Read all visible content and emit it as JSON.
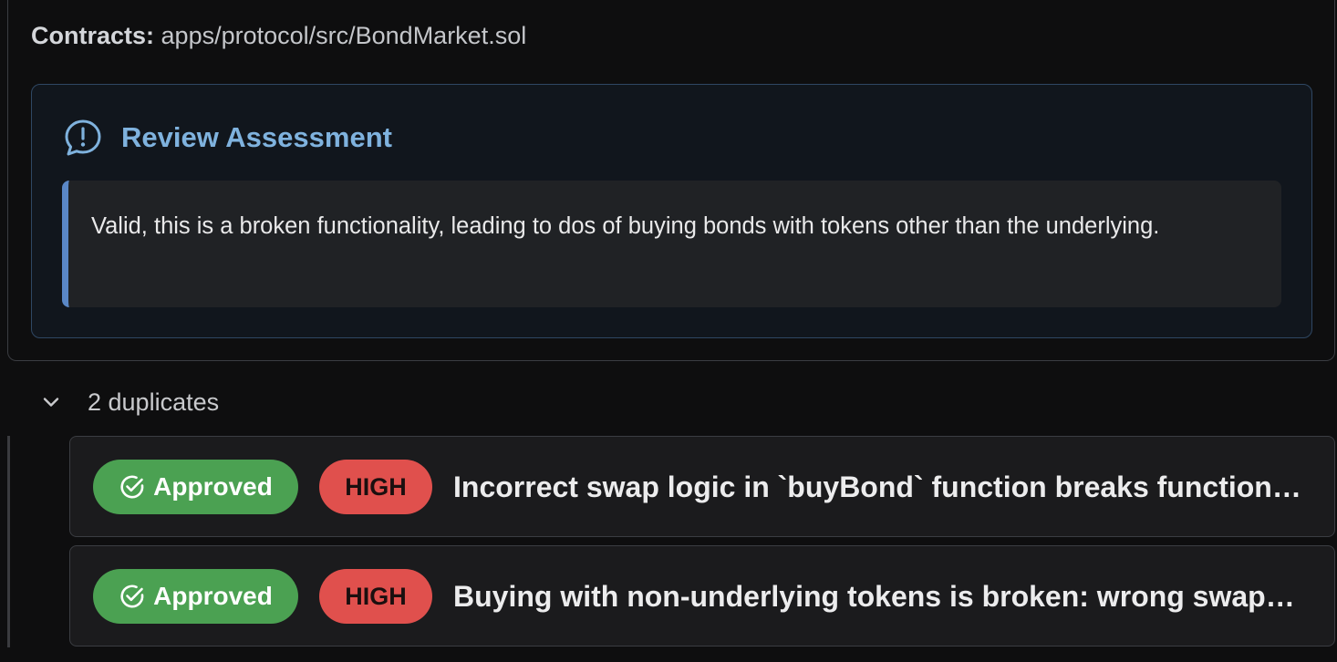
{
  "contracts": {
    "label": "Contracts:",
    "path": "apps/protocol/src/BondMarket.sol"
  },
  "assessment": {
    "icon": "message-alert-icon",
    "title": "Review Assessment",
    "text": "Valid, this is a broken functionality, leading to dos of buying bonds with tokens other than the underlying."
  },
  "duplicates": {
    "toggle_icon": "chevron-down-icon",
    "label": "2 duplicates",
    "items": [
      {
        "status": "Approved",
        "severity": "HIGH",
        "title": "Incorrect swap logic in `buyBond` function breaks functionality for non-underlying tokens"
      },
      {
        "status": "Approved",
        "severity": "HIGH",
        "title": "Buying with non-underlying tokens is broken: wrong swap direction and amounts"
      }
    ]
  },
  "colors": {
    "accent": "#7fb2de",
    "approved": "#4ba152",
    "high": "#e0504d",
    "quote_bar": "#5a87c6"
  }
}
